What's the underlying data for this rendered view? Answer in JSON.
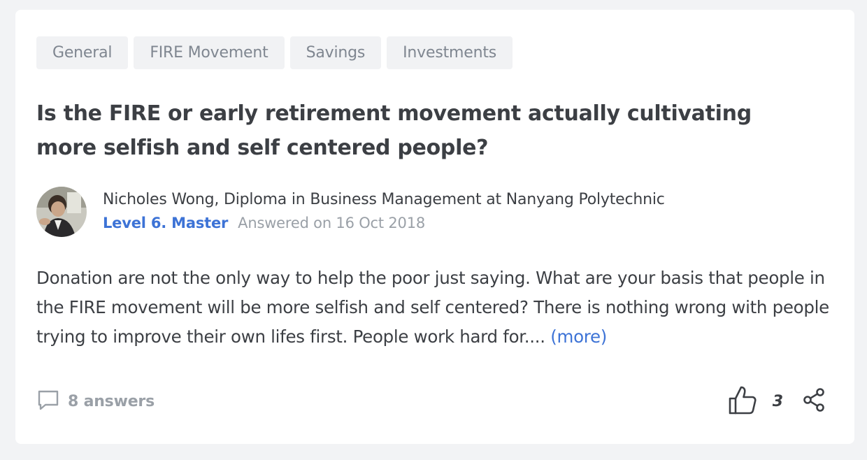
{
  "tags": [
    "General",
    "FIRE Movement",
    "Savings",
    "Investments"
  ],
  "question": {
    "title": "Is the FIRE or early retirement movement actually cultivating more selfish and self centered people?"
  },
  "author": {
    "name_line": "Nicholes Wong, Diploma in Business Management at Nanyang Polytechnic",
    "level": "Level 6. Master",
    "answered": "Answered on 16 Oct 2018"
  },
  "answer": {
    "text": "Donation are not the only way to help the poor just saying. What are your basis that people in the FIRE movement will be more selfish and self centered? There is nothing wrong with people trying to improve their own lifes first. People work hard for....",
    "more_label": "(more)"
  },
  "footer": {
    "answers_label": "8 answers",
    "like_count": "3"
  },
  "colors": {
    "accent": "#3d73d6",
    "text": "#3c3f44",
    "muted": "#9aa0a7",
    "tag_bg": "#f1f2f4",
    "page_bg": "#f2f3f5"
  },
  "icons": {
    "answers": "speech-bubble-icon",
    "like": "thumbs-up-icon",
    "share": "share-icon"
  }
}
